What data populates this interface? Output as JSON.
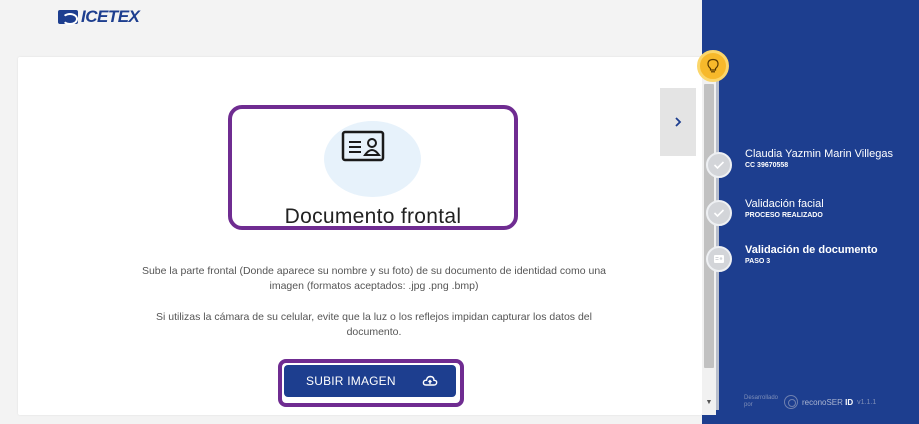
{
  "header": {
    "logo_text": "ICETEX"
  },
  "document": {
    "title": "Documento frontal",
    "instruction": "Sube la parte frontal (Donde aparece su nombre y su foto) de su documento de identidad como una imagen (formatos aceptados: .jpg .png .bmp)",
    "tip": "Si utilizas la cámara de su celular, evite que la luz o los reflejos impidan capturar los datos del documento."
  },
  "upload": {
    "label": "SUBIR IMAGEN",
    "icon": "cloud-upload-icon"
  },
  "nav": {
    "next_icon": "chevron-right-icon",
    "next_glyph": "›"
  },
  "steps": [
    {
      "name": "Claudia Yazmin Marin Villegas",
      "sub": "CC 39670558",
      "state": "done"
    },
    {
      "name": "Validación facial",
      "sub": "PROCESO REALIZADO",
      "state": "done"
    },
    {
      "name": "Validación de documento",
      "sub": "PASO 3",
      "state": "active"
    }
  ],
  "footer": {
    "developed_by": "Desarrollado por",
    "brand_prefix": "reconoSER",
    "brand_suffix": "ID",
    "version": "v1.1.1"
  },
  "colors": {
    "brand_blue": "#1d3e8f",
    "highlight_purple": "#6f2c91",
    "bulb_yellow": "#f7b92b"
  }
}
